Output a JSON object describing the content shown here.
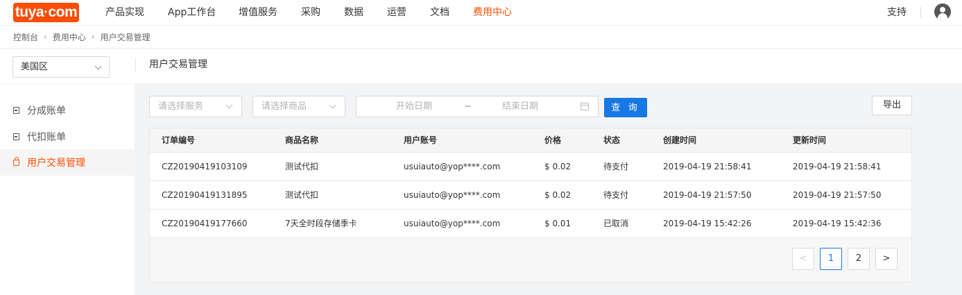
{
  "brand": {
    "logo_text": "tuya·com",
    "accent": "#ff4d00",
    "primary": "#1677e5"
  },
  "nav": {
    "items": [
      "产品实现",
      "App工作台",
      "增值服务",
      "采购",
      "数据",
      "运营",
      "文档",
      "费用中心"
    ],
    "active_index": 7,
    "support": "支持",
    "avatar_icon": "user-avatar-icon"
  },
  "breadcrumb": [
    "控制台",
    "费用中心",
    "用户交易管理"
  ],
  "region": {
    "selected": "美国区"
  },
  "page_title": "用户交易管理",
  "sidebar": {
    "items": [
      {
        "label": "分成账单",
        "icon": "document-icon",
        "active": false
      },
      {
        "label": "代扣账单",
        "icon": "document-icon",
        "active": false
      },
      {
        "label": "用户交易管理",
        "icon": "shopping-bag-icon",
        "active": true
      }
    ]
  },
  "filters": {
    "service_placeholder": "请选择服务",
    "product_placeholder": "请选择商品",
    "start_date_placeholder": "开始日期",
    "range_separator": "~",
    "end_date_placeholder": "结束日期",
    "query_label": "查 询",
    "export_label": "导出"
  },
  "table": {
    "columns": [
      "订单编号",
      "商品名称",
      "用户账号",
      "价格",
      "状态",
      "创建时间",
      "更新时间"
    ],
    "rows": [
      [
        "CZ20190419103109",
        "测试代扣",
        "usuiauto@yop****.com",
        "$ 0.02",
        "待支付",
        "2019-04-19 21:58:41",
        "2019-04-19 21:58:41"
      ],
      [
        "CZ20190419131895",
        "测试代扣",
        "usuiauto@yop****.com",
        "$ 0.02",
        "待支付",
        "2019-04-19 21:57:50",
        "2019-04-19 21:57:50"
      ],
      [
        "CZ20190419177660",
        "7天全时段存储季卡",
        "usuiauto@yop****.com",
        "$ 0.01",
        "已取消",
        "2019-04-19 15:42:26",
        "2019-04-19 15:42:36"
      ]
    ]
  },
  "pagination": {
    "prev": "<",
    "pages": [
      "1",
      "2"
    ],
    "current": "1",
    "next": ">"
  }
}
